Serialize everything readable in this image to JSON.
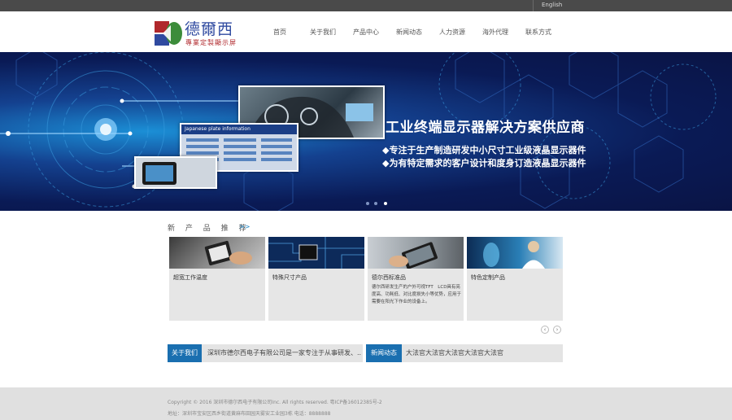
{
  "topbar": {
    "language": "English"
  },
  "logo": {
    "name": "德爾西",
    "tagline": "專業定製顯示屏"
  },
  "nav": {
    "items": [
      {
        "label": "首页"
      },
      {
        "label": "关于我们"
      },
      {
        "label": "产品中心"
      },
      {
        "label": "新闻动态"
      },
      {
        "label": "人力资源"
      },
      {
        "label": "海外代理"
      },
      {
        "label": "联系方式"
      }
    ]
  },
  "banner": {
    "title": "工业终端显示器解决方案供应商",
    "line1": "◆专注于生产制造研发中小尺寸工业级液晶显示器件",
    "line2": "◆为有特定需求的客户设计和度身订造液晶显示器件",
    "screen_text": "Japanese plate information",
    "slide_count": 3,
    "active_slide": 3
  },
  "products": {
    "title": "新 产 品 推 荐",
    "more": ">>",
    "items": [
      {
        "name": "超宽工作温度",
        "desc": ""
      },
      {
        "name": "特殊尺寸产品",
        "desc": ""
      },
      {
        "name": "德尔西标准品",
        "desc": "德尔西研发生产的户外可视TFT　LCD具有亮度高、功耗低、对比度损失小等优势，应用于需要在阳光下作业的设备上。"
      },
      {
        "name": "特色定制产品",
        "desc": ""
      }
    ],
    "prev": "‹",
    "next": "›"
  },
  "about": {
    "tag": "关于我们",
    "text": "深圳市德尔西电子有限公司是一家专注于从事研发、..."
  },
  "news": {
    "tag": "新闻动态",
    "text": "大法官大法官大法官大法官大法官"
  },
  "footer": {
    "copyright": "Copyright © 2016 深圳市德尔西电子有限公司Inc. All rights reserved. 粤ICP备16012385号-2",
    "address": "地址：深圳市宝安区西乡街道黄麻布田园天雾安工业园3栋  电话：8888888"
  },
  "colors": {
    "accent": "#1a6fb0",
    "banner_dark": "#0a1a55",
    "logo_blue": "#2f4aa0",
    "logo_red": "#b0282c",
    "logo_green": "#3c8c3a"
  }
}
